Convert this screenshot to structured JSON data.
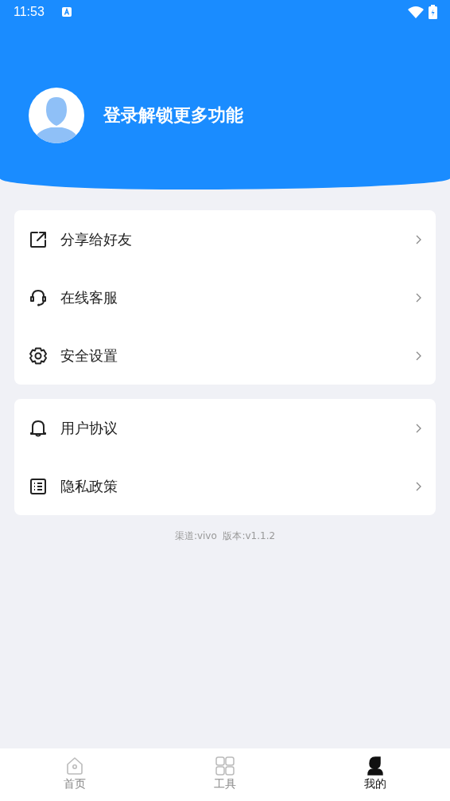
{
  "status_bar": {
    "time": "11:53"
  },
  "profile": {
    "login_prompt": "登录解锁更多功能"
  },
  "menu_groups": [
    [
      {
        "kind": "share",
        "label": "分享给好友"
      },
      {
        "kind": "headset",
        "label": "在线客服"
      },
      {
        "kind": "gear",
        "label": "安全设置"
      }
    ],
    [
      {
        "kind": "bell",
        "label": "用户协议"
      },
      {
        "kind": "list",
        "label": "隐私政策"
      }
    ]
  ],
  "version_info": "渠道:vivo  版本:v1.1.2",
  "bottom_nav": [
    {
      "kind": "home",
      "label": "首页",
      "selected": false
    },
    {
      "kind": "grid",
      "label": "工具",
      "selected": false
    },
    {
      "kind": "person",
      "label": "我的",
      "selected": true
    }
  ]
}
